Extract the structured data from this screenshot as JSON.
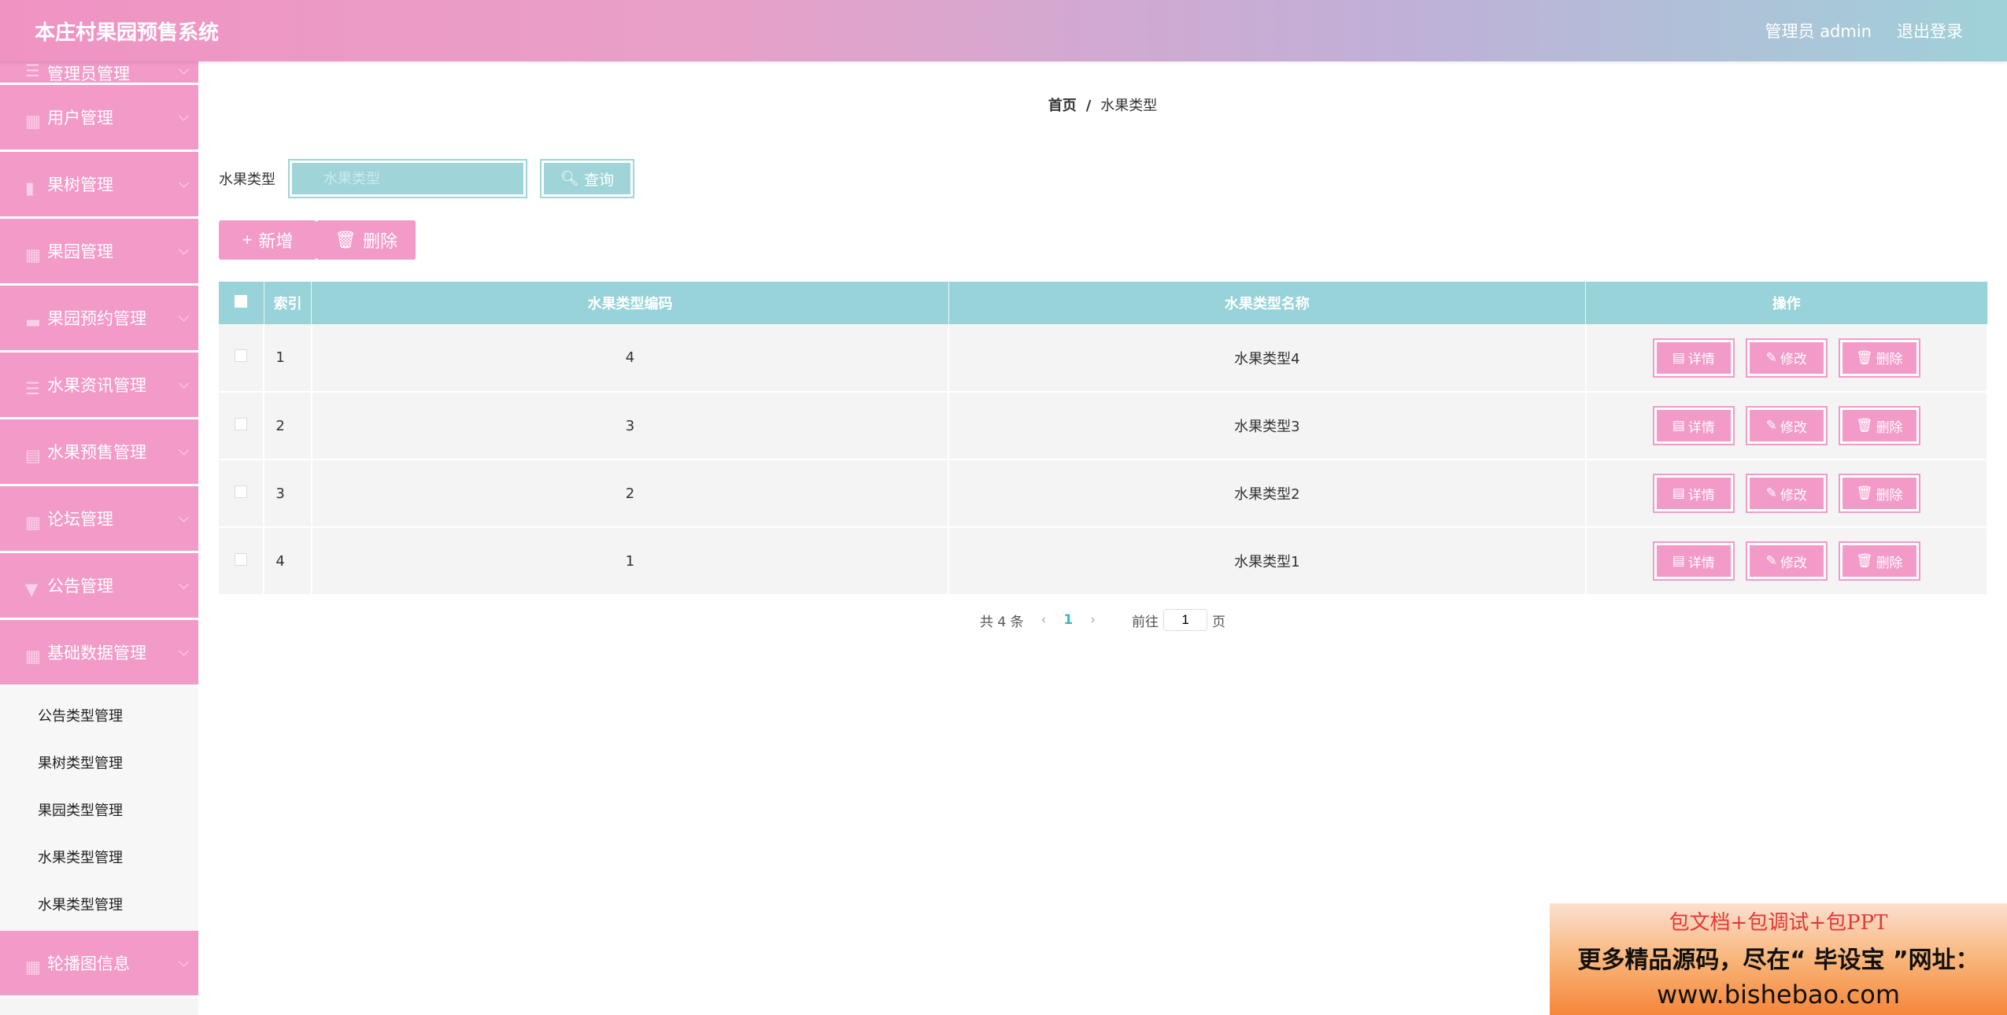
{
  "header": {
    "title": "本庄村果园预售系统",
    "user_label": "管理员 admin",
    "logout_label": "退出登录"
  },
  "sidebar": {
    "items": [
      {
        "label": "管理员管理"
      },
      {
        "label": "用户管理"
      },
      {
        "label": "果树管理"
      },
      {
        "label": "果园管理"
      },
      {
        "label": "果园预约管理"
      },
      {
        "label": "水果资讯管理"
      },
      {
        "label": "水果预售管理"
      },
      {
        "label": "论坛管理"
      },
      {
        "label": "公告管理"
      },
      {
        "label": "基础数据管理"
      }
    ],
    "subitems": [
      {
        "label": "公告类型管理"
      },
      {
        "label": "果树类型管理"
      },
      {
        "label": "果园类型管理"
      },
      {
        "label": "水果类型管理"
      },
      {
        "label": "水果类型管理"
      }
    ],
    "last_item": {
      "label": "轮播图信息"
    }
  },
  "breadcrumb": {
    "home": "首页",
    "separator": "/",
    "current": "水果类型"
  },
  "search": {
    "label": "水果类型",
    "placeholder": "水果类型",
    "value": "",
    "button_label": "查询"
  },
  "actions": {
    "add_label": "新增",
    "delete_label": "删除"
  },
  "table": {
    "columns": [
      "索引",
      "水果类型编码",
      "水果类型名称",
      "操作"
    ],
    "rows": [
      {
        "index": "1",
        "code": "4",
        "name": "水果类型4"
      },
      {
        "index": "2",
        "code": "3",
        "name": "水果类型3"
      },
      {
        "index": "3",
        "code": "2",
        "name": "水果类型2"
      },
      {
        "index": "4",
        "code": "1",
        "name": "水果类型1"
      }
    ],
    "row_actions": {
      "detail": "详情",
      "edit": "修改",
      "delete": "删除"
    }
  },
  "pagination": {
    "total_text": "共 4 条",
    "current_page": "1",
    "goto_prefix": "前往",
    "goto_value": "1",
    "goto_suffix": "页"
  },
  "watermark": {
    "line1": "包文档+包调试+包PPT",
    "line2": "更多精品源码，尽在“ 毕设宝 ”网址：",
    "line3": "www.bishebao.com"
  },
  "colors": {
    "accent_pink": "#f29ac8",
    "accent_teal": "#97d3d8"
  }
}
